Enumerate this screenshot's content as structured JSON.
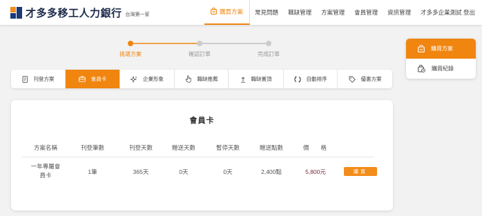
{
  "header": {
    "logo_text": "才多多移工人力銀行",
    "logo_sub": "台灣第一家",
    "nav": [
      {
        "label": "購買方案",
        "icon": "shopping-bag-icon",
        "active": true
      },
      {
        "label": "常見問題"
      },
      {
        "label": "職缺管理"
      },
      {
        "label": "方案管理"
      },
      {
        "label": "會員管理"
      },
      {
        "label": "資訊管理"
      },
      {
        "label": "才多多企業測試 登出"
      }
    ]
  },
  "stepper": {
    "steps": [
      {
        "label": "挑選方案",
        "active": true
      },
      {
        "label": "確認訂單",
        "active": false
      },
      {
        "label": "完成訂單",
        "active": false
      }
    ]
  },
  "tabs": [
    {
      "label": "刊登方案",
      "icon": "document-icon"
    },
    {
      "label": "會員卡",
      "icon": "briefcase-icon",
      "active": true
    },
    {
      "label": "企業形象",
      "icon": "sparkle-icon"
    },
    {
      "label": "職缺推薦",
      "icon": "hand-pointer-icon"
    },
    {
      "label": "職缺置頂",
      "icon": "arrow-up-icon"
    },
    {
      "label": "自動排序",
      "icon": "refresh-icon"
    },
    {
      "label": "優惠方案",
      "icon": "tag-icon"
    }
  ],
  "card": {
    "title": "會員卡",
    "columns": [
      "方案名稱",
      "刊登筆數",
      "刊登天數",
      "贈送天數",
      "暫停天數",
      "贈送點數",
      "價　　格"
    ],
    "row": {
      "name": "一年專屬會員卡",
      "count": "1筆",
      "days": "365天",
      "bonus_days": "0天",
      "pause_days": "0天",
      "points": "2,400點",
      "price": "5,800元",
      "button": "購買"
    }
  },
  "side": {
    "items": [
      {
        "label": "購買方案",
        "icon": "shopping-bag-icon",
        "active": true
      },
      {
        "label": "購買紀錄",
        "icon": "bag-clock-icon"
      }
    ]
  },
  "colors": {
    "accent": "#f0850f",
    "brand_navy": "#1c2a4a",
    "price": "#7a2a3a"
  }
}
